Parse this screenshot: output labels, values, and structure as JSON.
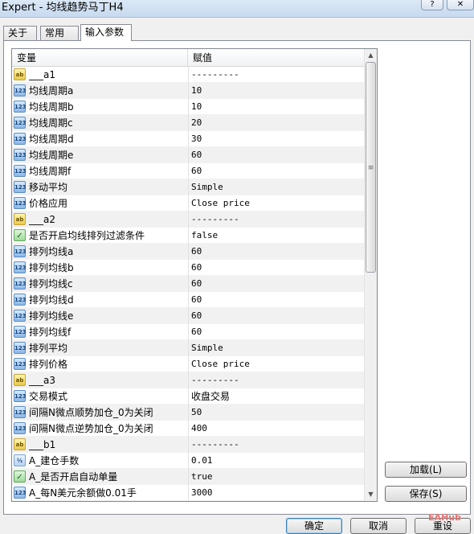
{
  "window": {
    "title": "Expert - 均线趋势马丁H4",
    "help_btn": "?",
    "close_btn": "✕"
  },
  "tabs": [
    {
      "label": "关于"
    },
    {
      "label": "常用"
    },
    {
      "label": "输入参数"
    }
  ],
  "grid": {
    "col_variable": "变量",
    "col_value": "赋值",
    "rows": [
      {
        "type": "string",
        "icon": "ab",
        "name": "___a1",
        "value": "---------"
      },
      {
        "type": "int",
        "icon": "123",
        "name": "均线周期a",
        "value": "10"
      },
      {
        "type": "int",
        "icon": "123",
        "name": "均线周期b",
        "value": "10"
      },
      {
        "type": "int",
        "icon": "123",
        "name": "均线周期c",
        "value": "20"
      },
      {
        "type": "int",
        "icon": "123",
        "name": "均线周期d",
        "value": "30"
      },
      {
        "type": "int",
        "icon": "123",
        "name": "均线周期e",
        "value": "60"
      },
      {
        "type": "int",
        "icon": "123",
        "name": "均线周期f",
        "value": "60"
      },
      {
        "type": "int",
        "icon": "123",
        "name": "移动平均",
        "value": "Simple"
      },
      {
        "type": "int",
        "icon": "123",
        "name": "价格应用",
        "value": "Close price"
      },
      {
        "type": "string",
        "icon": "ab",
        "name": "___a2",
        "value": "---------"
      },
      {
        "type": "bool",
        "icon": "✓",
        "name": "是否开启均线排列过滤条件",
        "value": "false"
      },
      {
        "type": "int",
        "icon": "123",
        "name": "排列均线a",
        "value": "60"
      },
      {
        "type": "int",
        "icon": "123",
        "name": "排列均线b",
        "value": "60"
      },
      {
        "type": "int",
        "icon": "123",
        "name": "排列均线c",
        "value": "60"
      },
      {
        "type": "int",
        "icon": "123",
        "name": "排列均线d",
        "value": "60"
      },
      {
        "type": "int",
        "icon": "123",
        "name": "排列均线e",
        "value": "60"
      },
      {
        "type": "int",
        "icon": "123",
        "name": "排列均线f",
        "value": "60"
      },
      {
        "type": "int",
        "icon": "123",
        "name": "排列平均",
        "value": "Simple"
      },
      {
        "type": "int",
        "icon": "123",
        "name": "排列价格",
        "value": "Close price"
      },
      {
        "type": "string",
        "icon": "ab",
        "name": "___a3",
        "value": "---------"
      },
      {
        "type": "int",
        "icon": "123",
        "name": "交易模式",
        "value": "收盘交易"
      },
      {
        "type": "int",
        "icon": "123",
        "name": "间隔N微点顺势加仓_0为关闭",
        "value": "50"
      },
      {
        "type": "int",
        "icon": "123",
        "name": "间隔N微点逆势加仓_0为关闭",
        "value": "400"
      },
      {
        "type": "string",
        "icon": "ab",
        "name": "___b1",
        "value": "---------"
      },
      {
        "type": "double",
        "icon": "½",
        "name": "A_建仓手数",
        "value": "0.01"
      },
      {
        "type": "bool",
        "icon": "✓",
        "name": "A_是否开启自动单量",
        "value": "true"
      },
      {
        "type": "int",
        "icon": "123",
        "name": "A_每N美元余额做0.01手",
        "value": "3000"
      }
    ]
  },
  "side_buttons": {
    "load": "加载(L)",
    "save": "保存(S)"
  },
  "footer": {
    "ok": "确定",
    "cancel": "取消",
    "reset": "重设"
  },
  "watermark": "EAHub",
  "colors": {
    "accent": "#3c7fb1",
    "row_alt": "#f1f1f1"
  }
}
